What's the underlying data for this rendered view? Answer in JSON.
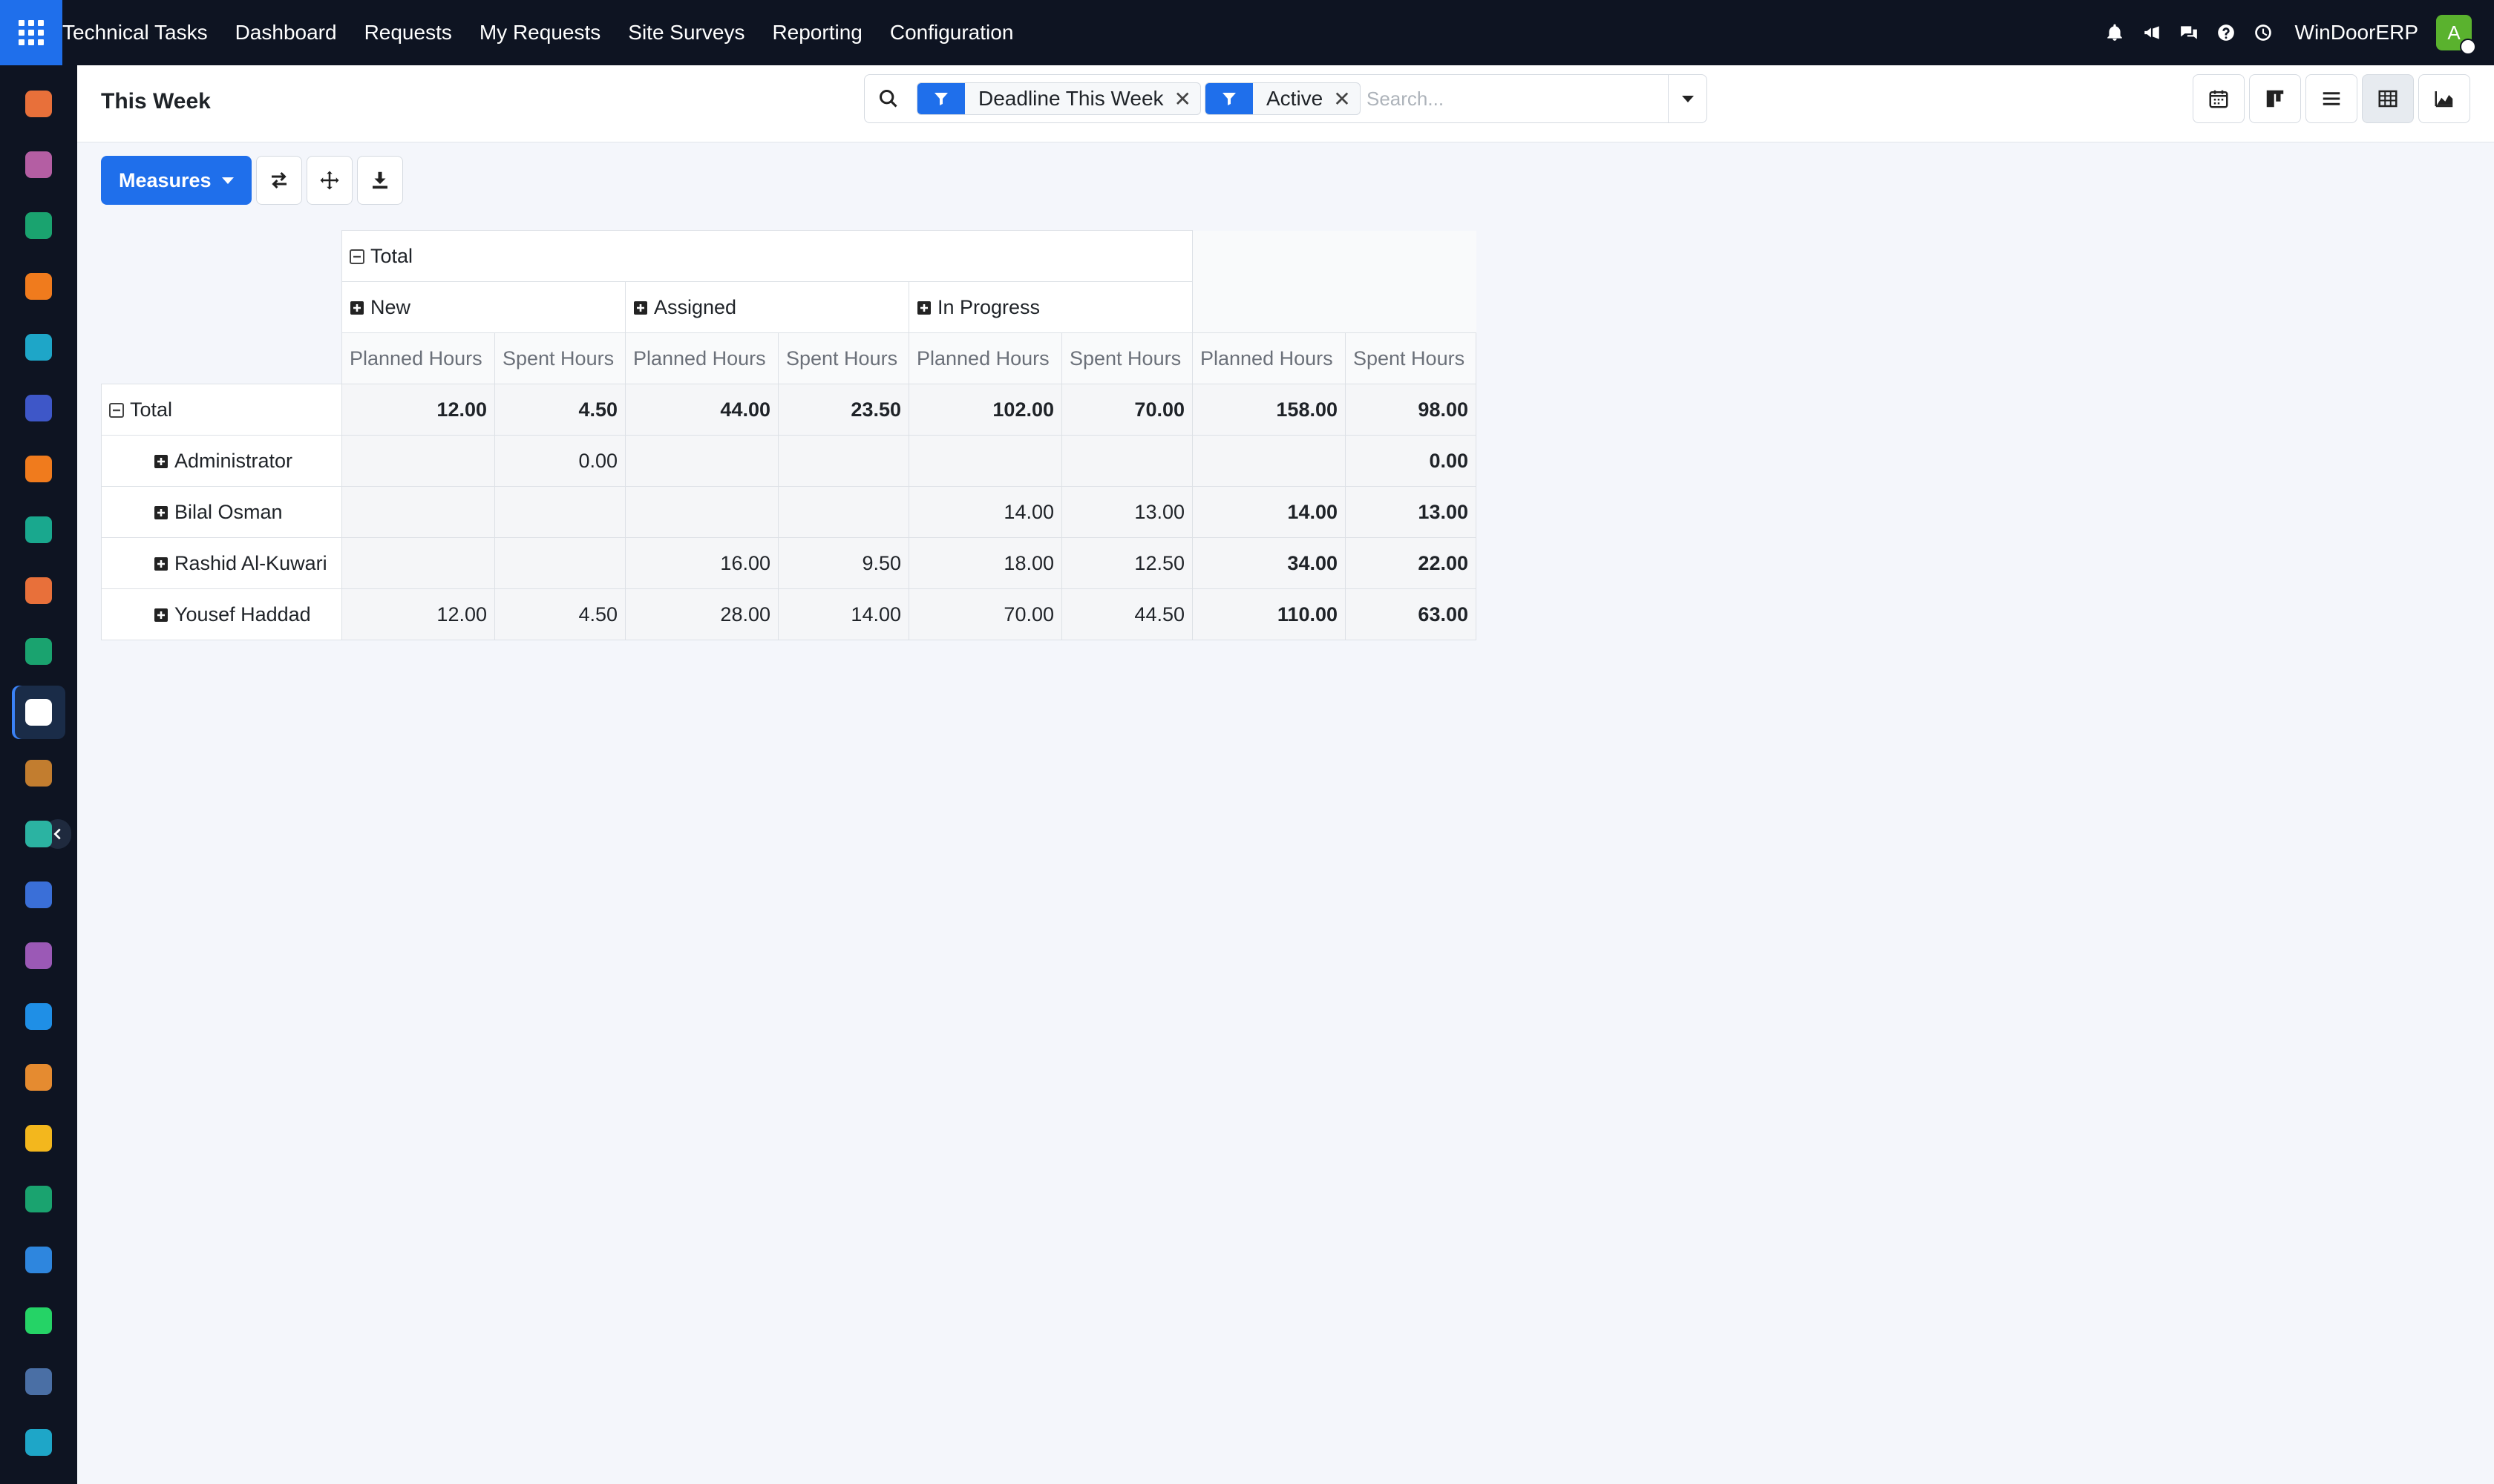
{
  "topbar": {
    "app_name": "Technical Tasks",
    "menu": [
      "Dashboard",
      "Requests",
      "My Requests",
      "Site Surveys",
      "Reporting",
      "Configuration"
    ],
    "company": "WinDoorERP",
    "avatar_letter": "A",
    "icons": [
      "bell-icon",
      "megaphone-icon",
      "chat-icon",
      "help-icon",
      "clock-icon"
    ]
  },
  "sidebar": {
    "apps": [
      {
        "icon": "chart-bars-icon",
        "color": "#e8703a"
      },
      {
        "icon": "inventory-icon",
        "color": "#b45ea3"
      },
      {
        "icon": "contacts-icon",
        "color": "#1aa36f"
      },
      {
        "icon": "discuss-icon",
        "color": "#f07b1d"
      },
      {
        "icon": "sync-icon",
        "color": "#1ea6c8"
      },
      {
        "icon": "mail-icon",
        "color": "#3e57c8"
      },
      {
        "icon": "chat-bubble-icon",
        "color": "#f07b1d"
      },
      {
        "icon": "check-arrow-icon",
        "color": "#19a88e"
      },
      {
        "icon": "sales-chart-icon",
        "color": "#e8703a"
      },
      {
        "icon": "employees-icon",
        "color": "#1aa36f"
      },
      {
        "icon": "technical-tasks-icon",
        "color": "#ffffff"
      },
      {
        "icon": "stock-icon",
        "color": "#c27d2f"
      },
      {
        "icon": "tasks-check-icon",
        "color": "#2bb3a2"
      },
      {
        "icon": "knowledge-icon",
        "color": "#3a6fd8"
      },
      {
        "icon": "package-icon",
        "color": "#9b59b6"
      },
      {
        "icon": "invoice-icon",
        "color": "#1f8fe6"
      },
      {
        "icon": "team-icon",
        "color": "#e58b30"
      },
      {
        "icon": "calendar-icon",
        "color": "#f3b71d"
      },
      {
        "icon": "sign-icon",
        "color": "#1aa36f"
      },
      {
        "icon": "dashboard-icon",
        "color": "#2e86de"
      },
      {
        "icon": "whatsapp-icon",
        "color": "#25d366"
      },
      {
        "icon": "timer-icon",
        "color": "#4a6fa5"
      },
      {
        "icon": "sync2-icon",
        "color": "#1ea6c8"
      }
    ],
    "active_index": 10
  },
  "control_panel": {
    "title": "This Week",
    "filters": [
      "Deadline This Week",
      "Active"
    ],
    "search_placeholder": "Search...",
    "views": [
      "calendar-view-icon",
      "kanban-view-icon",
      "list-view-icon",
      "pivot-view-icon",
      "graph-view-icon"
    ],
    "active_view": "pivot-view-icon"
  },
  "toolbar": {
    "measures_label": "Measures",
    "buttons": [
      "flip-axis-icon",
      "expand-all-icon",
      "download-icon"
    ]
  },
  "pivot": {
    "col_total_label": "Total",
    "col_groups": [
      "New",
      "Assigned",
      "In Progress"
    ],
    "measures": [
      "Planned Hours",
      "Spent Hours"
    ],
    "row_total_label": "Total",
    "total_row": [
      "12.00",
      "4.50",
      "44.00",
      "23.50",
      "102.00",
      "70.00",
      "158.00",
      "98.00"
    ],
    "rows": [
      {
        "name": "Administrator",
        "values": [
          "",
          "0.00",
          "",
          "",
          "",
          "",
          "",
          "0.00"
        ]
      },
      {
        "name": "Bilal Osman",
        "values": [
          "",
          "",
          "",
          "",
          "14.00",
          "13.00",
          "14.00",
          "13.00"
        ]
      },
      {
        "name": "Rashid Al-Kuwari",
        "values": [
          "",
          "",
          "16.00",
          "9.50",
          "18.00",
          "12.50",
          "34.00",
          "22.00"
        ]
      },
      {
        "name": "Yousef Haddad",
        "values": [
          "12.00",
          "4.50",
          "28.00",
          "14.00",
          "70.00",
          "44.50",
          "110.00",
          "63.00"
        ]
      }
    ]
  }
}
